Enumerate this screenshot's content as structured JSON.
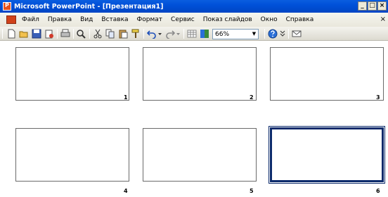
{
  "window": {
    "title": "Microsoft PowerPoint - [Презентация1]",
    "app_icon_letter": "P",
    "controls": {
      "minimize": "_",
      "restore": "□",
      "close": "×"
    }
  },
  "menubar": {
    "items": [
      "Файл",
      "Правка",
      "Вид",
      "Вставка",
      "Формат",
      "Сервис",
      "Показ слайдов",
      "Окно",
      "Справка"
    ],
    "close": "×"
  },
  "toolbar": {
    "icons": [
      "new-icon",
      "open-icon",
      "save-icon",
      "permission-icon",
      "print-icon",
      "print-preview-icon",
      "spelling-icon",
      "cut-icon",
      "copy-icon",
      "paste-icon",
      "format-painter-icon",
      "undo-icon",
      "redo-icon",
      "table-icon",
      "color-grayscale-icon",
      "help-icon",
      "toolbar-options-icon",
      "mail-icon"
    ],
    "zoom": "66%"
  },
  "slides": [
    {
      "number": "1",
      "selected": false
    },
    {
      "number": "2",
      "selected": false
    },
    {
      "number": "3",
      "selected": false
    },
    {
      "number": "4",
      "selected": false
    },
    {
      "number": "5",
      "selected": false
    },
    {
      "number": "6",
      "selected": true
    }
  ],
  "colors": {
    "titlebar": "#0054e3",
    "selected_border": "#0b2a6b"
  }
}
